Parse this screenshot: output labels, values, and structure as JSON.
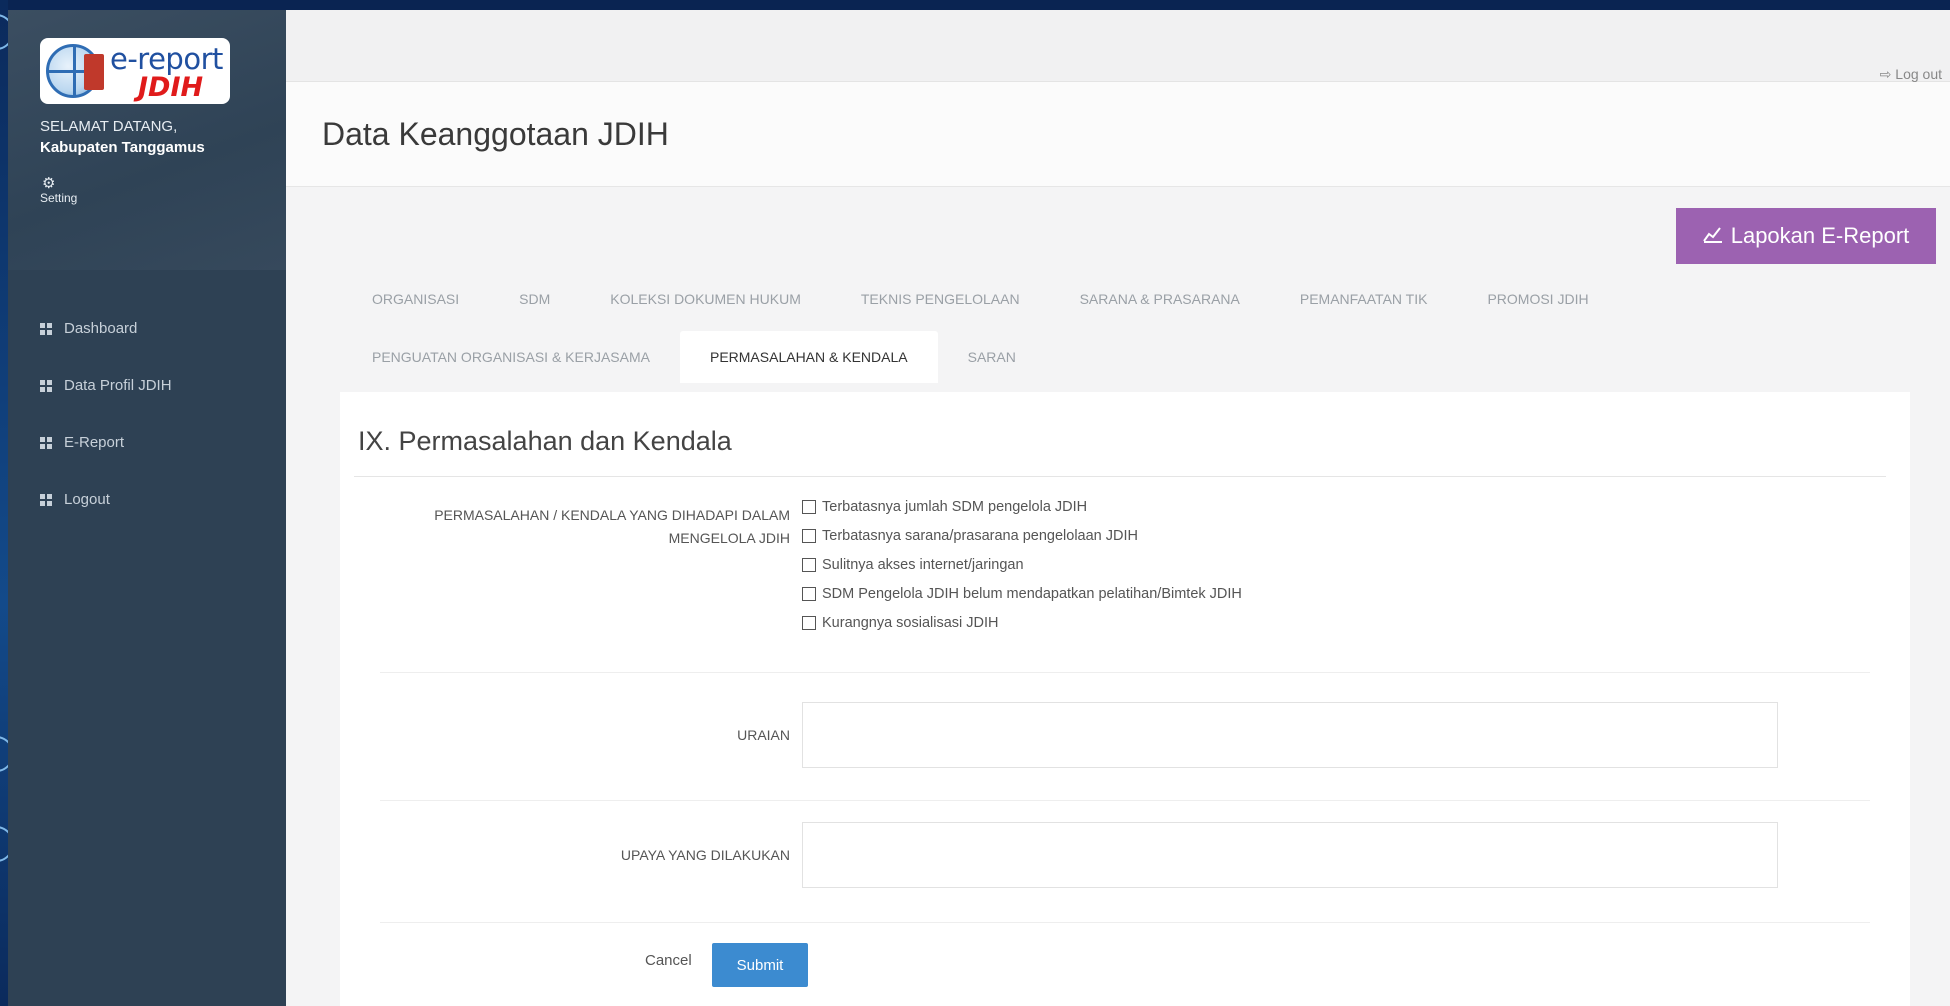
{
  "sidebar": {
    "logo": {
      "text_main": "e-report",
      "text_accent": "JDIH"
    },
    "welcome": "SELAMAT DATANG,",
    "region": "Kabupaten Tanggamus",
    "setting_label": "Setting",
    "items": [
      {
        "label": "Dashboard",
        "icon": "grid-icon"
      },
      {
        "label": "Data Profil JDIH",
        "icon": "grid-icon"
      },
      {
        "label": "E-Report",
        "icon": "grid-icon"
      },
      {
        "label": "Logout",
        "icon": "grid-icon"
      }
    ]
  },
  "topbar": {
    "logout_label": "Log out",
    "logout_icon": "sign-out-icon"
  },
  "page": {
    "title": "Data Keanggotaan JDIH"
  },
  "report_button": {
    "label": "Lapokan E-Report",
    "icon": "line-chart-icon",
    "color": "#9c62b1"
  },
  "tabs": {
    "row1": [
      "ORGANISASI",
      "SDM",
      "KOLEKSI DOKUMEN HUKUM",
      "TEKNIS PENGELOLAAN",
      "SARANA & PRASARANA",
      "PEMANFAATAN TIK",
      "PROMOSI JDIH"
    ],
    "row2": [
      "PENGUATAN ORGANISASI & KERJASAMA",
      "PERMASALAHAN & KENDALA",
      "SARAN"
    ],
    "active": "PERMASALAHAN & KENDALA"
  },
  "form": {
    "section_title": "IX. Permasalahan dan Kendala",
    "issues_label_line1": "PERMASALAHAN / KENDALA YANG DIHADAPI DALAM",
    "issues_label_line2": "MENGELOLA JDIH",
    "issues": [
      "Terbatasnya jumlah SDM pengelola JDIH",
      "Terbatasnya sarana/prasarana pengelolaan JDIH",
      "Sulitnya akses internet/jaringan",
      "SDM Pengelola JDIH belum mendapatkan pelatihan/Bimtek JDIH",
      "Kurangnya sosialisasi JDIH"
    ],
    "uraian_label": "URAIAN",
    "uraian_value": "",
    "upaya_label": "UPAYA YANG DILAKUKAN",
    "upaya_value": "",
    "cancel_label": "Cancel",
    "submit_label": "Submit",
    "submit_color": "#3c8bd0"
  }
}
